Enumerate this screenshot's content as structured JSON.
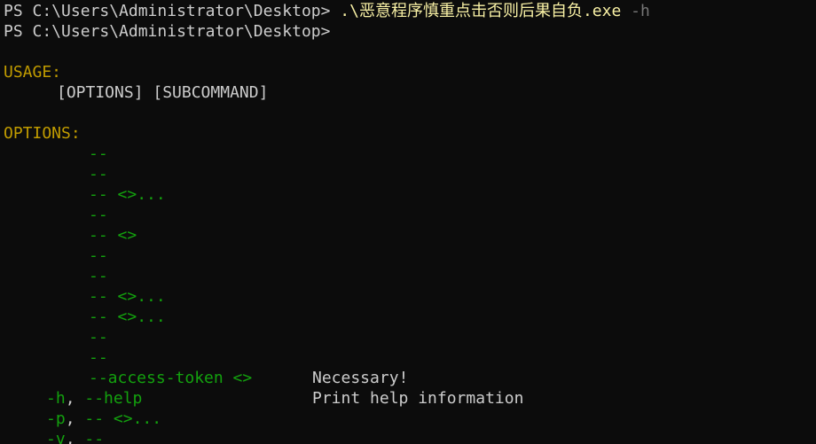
{
  "terminal": {
    "prompt1": "PS C:\\Users\\Administrator\\Desktop> ",
    "command": ".\\恶意程序慎重点击否则后果自负.exe",
    "command_flag": " -h",
    "prompt2": "PS C:\\Users\\Administrator\\Desktop>",
    "usage_heading": "USAGE:",
    "usage_text": "[OPTIONS] [SUBCOMMAND]",
    "options_heading": "OPTIONS:",
    "options": [
      {
        "flag": "--",
        "arg": "",
        "desc": ""
      },
      {
        "flag": "--",
        "arg": "",
        "desc": ""
      },
      {
        "flag": "--",
        "arg": " <>...",
        "desc": ""
      },
      {
        "flag": "--",
        "arg": "",
        "desc": ""
      },
      {
        "flag": "--",
        "arg": " <>",
        "desc": ""
      },
      {
        "flag": "--",
        "arg": "",
        "desc": ""
      },
      {
        "flag": "--",
        "arg": "",
        "desc": ""
      },
      {
        "flag": "--",
        "arg": " <>...",
        "desc": ""
      },
      {
        "flag": "--",
        "arg": " <>...",
        "desc": ""
      },
      {
        "flag": "--",
        "arg": "",
        "desc": ""
      },
      {
        "flag": "--",
        "arg": "",
        "desc": ""
      },
      {
        "flag": "--access-token",
        "arg": " <>",
        "desc": "Necessary!"
      }
    ],
    "short_options": [
      {
        "short": "-h",
        "sep": ", ",
        "long": "--help",
        "arg": "",
        "desc": "Print help information"
      },
      {
        "short": "-p",
        "sep": ", ",
        "long": "--",
        "arg": " <>...",
        "desc": ""
      },
      {
        "short": "-v",
        "sep": ", ",
        "long": "--",
        "arg": "",
        "desc": ""
      }
    ]
  },
  "colors": {
    "background": "#0c0c0c",
    "text": "#cccccc",
    "command": "#f9f1a5",
    "section": "#c19c00",
    "option": "#13a10e"
  }
}
